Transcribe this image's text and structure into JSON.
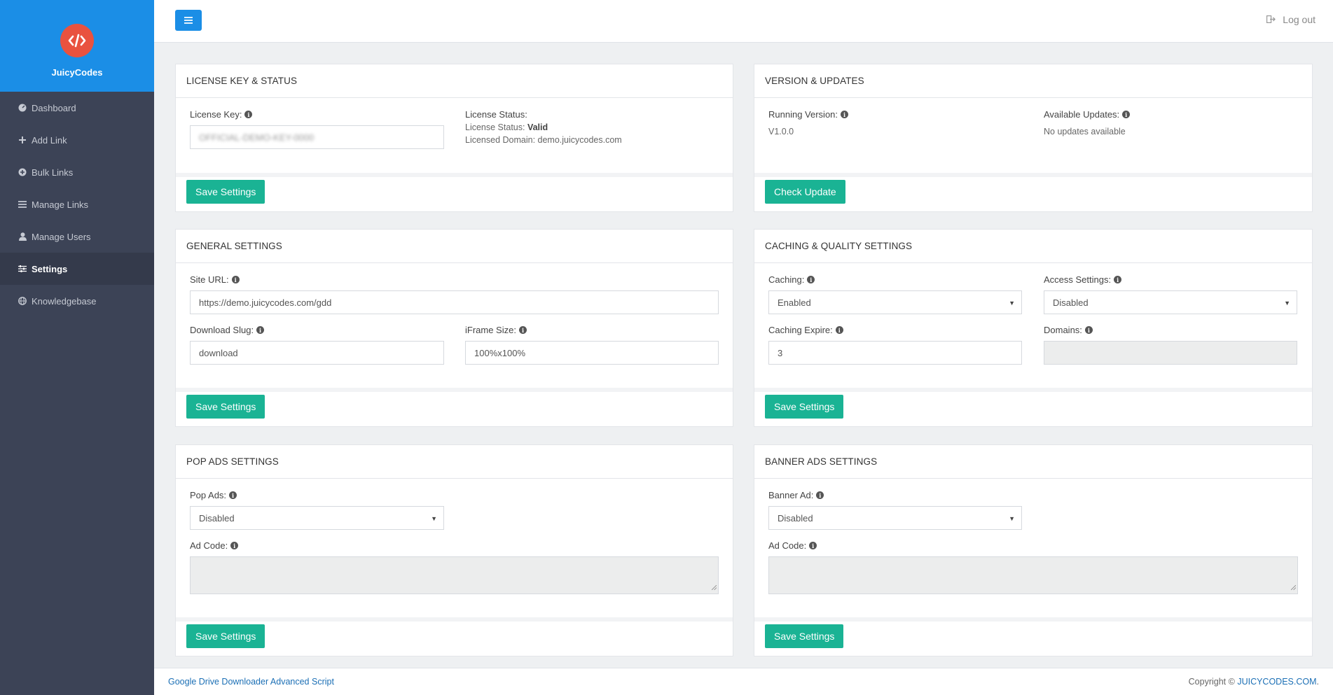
{
  "brand": {
    "name": "JuicyCodes"
  },
  "sidebar": {
    "items": [
      {
        "label": "Dashboard",
        "icon": "dashboard-icon"
      },
      {
        "label": "Add Link",
        "icon": "plus-icon"
      },
      {
        "label": "Bulk Links",
        "icon": "plus-circle-icon"
      },
      {
        "label": "Manage Links",
        "icon": "list-icon"
      },
      {
        "label": "Manage Users",
        "icon": "user-icon"
      },
      {
        "label": "Settings",
        "icon": "sliders-icon",
        "active": true
      },
      {
        "label": "Knowledgebase",
        "icon": "globe-icon"
      }
    ]
  },
  "topbar": {
    "logout_label": "Log out"
  },
  "license": {
    "title": "LICENSE KEY & STATUS",
    "key_label": "License Key:",
    "key_value": "OFFICIAL-DEMO-KEY-0000",
    "status_heading": "License Status:",
    "status_label": "License Status:",
    "status_value": "Valid",
    "domain_line": "Licensed Domain: demo.juicycodes.com",
    "save_label": "Save Settings"
  },
  "version": {
    "title": "VERSION & UPDATES",
    "running_label": "Running Version:",
    "running_value": "V1.0.0",
    "updates_label": "Available Updates:",
    "updates_value": "No updates available",
    "check_label": "Check Update"
  },
  "general": {
    "title": "GENERAL SETTINGS",
    "site_url_label": "Site URL:",
    "site_url_value": "https://demo.juicycodes.com/gdd",
    "slug_label": "Download Slug:",
    "slug_value": "download",
    "iframe_label": "iFrame Size:",
    "iframe_value": "100%x100%",
    "save_label": "Save Settings"
  },
  "caching": {
    "title": "CACHING & QUALITY SETTINGS",
    "caching_label": "Caching:",
    "caching_value": "Enabled",
    "access_label": "Access Settings:",
    "access_value": "Disabled",
    "expire_label": "Caching Expire:",
    "expire_value": "3",
    "domains_label": "Domains:",
    "domains_value": "",
    "save_label": "Save Settings"
  },
  "popads": {
    "title": "POP ADS SETTINGS",
    "pop_label": "Pop Ads:",
    "pop_value": "Disabled",
    "code_label": "Ad Code:",
    "save_label": "Save Settings"
  },
  "banner": {
    "title": "BANNER ADS SETTINGS",
    "banner_label": "Banner Ad:",
    "banner_value": "Disabled",
    "code_label": "Ad Code:",
    "save_label": "Save Settings"
  },
  "footer": {
    "left_link": "Google Drive Downloader Advanced Script",
    "copyright_prefix": "Copyright ©",
    "copyright_link": "JUICYCODES.COM",
    "copyright_suffix": "."
  },
  "colors": {
    "primary": "#1b8ee6",
    "success": "#1ab394",
    "sidebar": "#3c4356",
    "logo": "#e9523f"
  }
}
